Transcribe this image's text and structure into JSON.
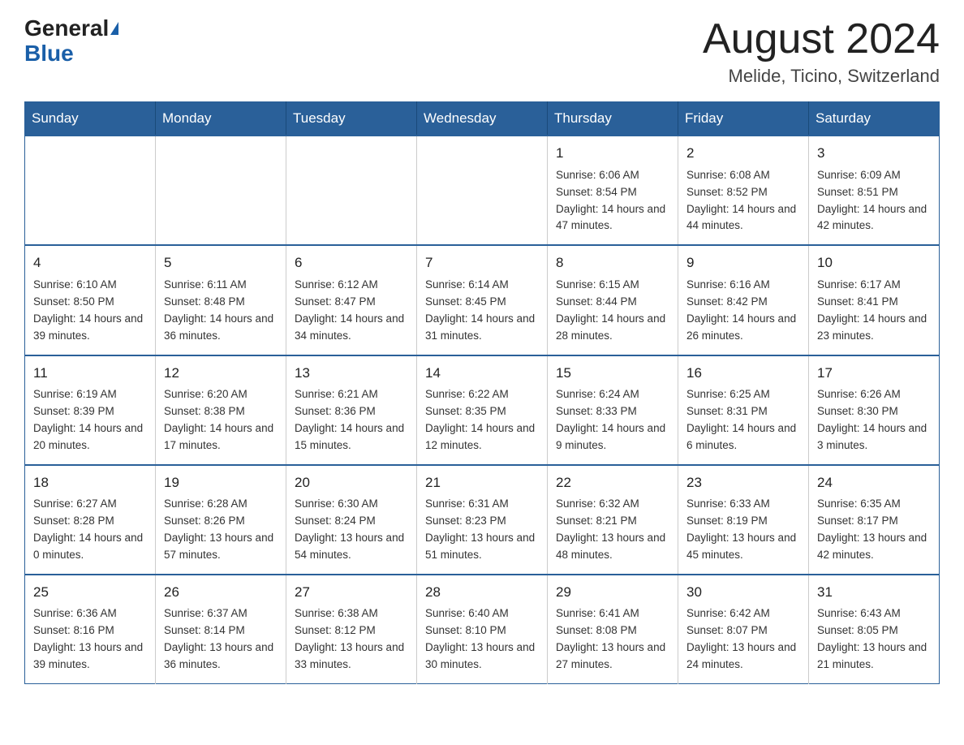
{
  "header": {
    "logo_general": "General",
    "logo_blue": "Blue",
    "month_title": "August 2024",
    "location": "Melide, Ticino, Switzerland"
  },
  "days_of_week": [
    "Sunday",
    "Monday",
    "Tuesday",
    "Wednesday",
    "Thursday",
    "Friday",
    "Saturday"
  ],
  "weeks": [
    [
      {
        "day": "",
        "info": ""
      },
      {
        "day": "",
        "info": ""
      },
      {
        "day": "",
        "info": ""
      },
      {
        "day": "",
        "info": ""
      },
      {
        "day": "1",
        "info": "Sunrise: 6:06 AM\nSunset: 8:54 PM\nDaylight: 14 hours and 47 minutes."
      },
      {
        "day": "2",
        "info": "Sunrise: 6:08 AM\nSunset: 8:52 PM\nDaylight: 14 hours and 44 minutes."
      },
      {
        "day": "3",
        "info": "Sunrise: 6:09 AM\nSunset: 8:51 PM\nDaylight: 14 hours and 42 minutes."
      }
    ],
    [
      {
        "day": "4",
        "info": "Sunrise: 6:10 AM\nSunset: 8:50 PM\nDaylight: 14 hours and 39 minutes."
      },
      {
        "day": "5",
        "info": "Sunrise: 6:11 AM\nSunset: 8:48 PM\nDaylight: 14 hours and 36 minutes."
      },
      {
        "day": "6",
        "info": "Sunrise: 6:12 AM\nSunset: 8:47 PM\nDaylight: 14 hours and 34 minutes."
      },
      {
        "day": "7",
        "info": "Sunrise: 6:14 AM\nSunset: 8:45 PM\nDaylight: 14 hours and 31 minutes."
      },
      {
        "day": "8",
        "info": "Sunrise: 6:15 AM\nSunset: 8:44 PM\nDaylight: 14 hours and 28 minutes."
      },
      {
        "day": "9",
        "info": "Sunrise: 6:16 AM\nSunset: 8:42 PM\nDaylight: 14 hours and 26 minutes."
      },
      {
        "day": "10",
        "info": "Sunrise: 6:17 AM\nSunset: 8:41 PM\nDaylight: 14 hours and 23 minutes."
      }
    ],
    [
      {
        "day": "11",
        "info": "Sunrise: 6:19 AM\nSunset: 8:39 PM\nDaylight: 14 hours and 20 minutes."
      },
      {
        "day": "12",
        "info": "Sunrise: 6:20 AM\nSunset: 8:38 PM\nDaylight: 14 hours and 17 minutes."
      },
      {
        "day": "13",
        "info": "Sunrise: 6:21 AM\nSunset: 8:36 PM\nDaylight: 14 hours and 15 minutes."
      },
      {
        "day": "14",
        "info": "Sunrise: 6:22 AM\nSunset: 8:35 PM\nDaylight: 14 hours and 12 minutes."
      },
      {
        "day": "15",
        "info": "Sunrise: 6:24 AM\nSunset: 8:33 PM\nDaylight: 14 hours and 9 minutes."
      },
      {
        "day": "16",
        "info": "Sunrise: 6:25 AM\nSunset: 8:31 PM\nDaylight: 14 hours and 6 minutes."
      },
      {
        "day": "17",
        "info": "Sunrise: 6:26 AM\nSunset: 8:30 PM\nDaylight: 14 hours and 3 minutes."
      }
    ],
    [
      {
        "day": "18",
        "info": "Sunrise: 6:27 AM\nSunset: 8:28 PM\nDaylight: 14 hours and 0 minutes."
      },
      {
        "day": "19",
        "info": "Sunrise: 6:28 AM\nSunset: 8:26 PM\nDaylight: 13 hours and 57 minutes."
      },
      {
        "day": "20",
        "info": "Sunrise: 6:30 AM\nSunset: 8:24 PM\nDaylight: 13 hours and 54 minutes."
      },
      {
        "day": "21",
        "info": "Sunrise: 6:31 AM\nSunset: 8:23 PM\nDaylight: 13 hours and 51 minutes."
      },
      {
        "day": "22",
        "info": "Sunrise: 6:32 AM\nSunset: 8:21 PM\nDaylight: 13 hours and 48 minutes."
      },
      {
        "day": "23",
        "info": "Sunrise: 6:33 AM\nSunset: 8:19 PM\nDaylight: 13 hours and 45 minutes."
      },
      {
        "day": "24",
        "info": "Sunrise: 6:35 AM\nSunset: 8:17 PM\nDaylight: 13 hours and 42 minutes."
      }
    ],
    [
      {
        "day": "25",
        "info": "Sunrise: 6:36 AM\nSunset: 8:16 PM\nDaylight: 13 hours and 39 minutes."
      },
      {
        "day": "26",
        "info": "Sunrise: 6:37 AM\nSunset: 8:14 PM\nDaylight: 13 hours and 36 minutes."
      },
      {
        "day": "27",
        "info": "Sunrise: 6:38 AM\nSunset: 8:12 PM\nDaylight: 13 hours and 33 minutes."
      },
      {
        "day": "28",
        "info": "Sunrise: 6:40 AM\nSunset: 8:10 PM\nDaylight: 13 hours and 30 minutes."
      },
      {
        "day": "29",
        "info": "Sunrise: 6:41 AM\nSunset: 8:08 PM\nDaylight: 13 hours and 27 minutes."
      },
      {
        "day": "30",
        "info": "Sunrise: 6:42 AM\nSunset: 8:07 PM\nDaylight: 13 hours and 24 minutes."
      },
      {
        "day": "31",
        "info": "Sunrise: 6:43 AM\nSunset: 8:05 PM\nDaylight: 13 hours and 21 minutes."
      }
    ]
  ]
}
